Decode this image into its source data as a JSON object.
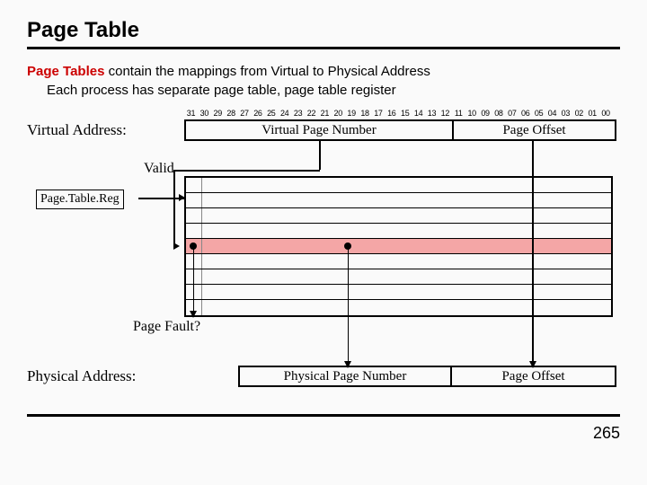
{
  "title": "Page Table",
  "body": {
    "line1_red": "Page Tables",
    "line1_rest": " contain the mappings from Virtual to Physical Address",
    "line2": "Each process has separate page table, page table register"
  },
  "bits": [
    "31",
    "30",
    "29",
    "28",
    "27",
    "26",
    "25",
    "24",
    "23",
    "22",
    "21",
    "20",
    "19",
    "18",
    "17",
    "16",
    "15",
    "14",
    "13",
    "12",
    "11",
    "10",
    "09",
    "08",
    "07",
    "06",
    "05",
    "04",
    "03",
    "02",
    "01",
    "00"
  ],
  "labels": {
    "virtual_address": "Virtual Address:",
    "vpn": "Virtual Page Number",
    "page_offset": "Page Offset",
    "valid": "Valid",
    "ptr": "Page.Table.Reg",
    "page_fault": "Page Fault?",
    "physical_address": "Physical Address:",
    "ppn": "Physical Page Number"
  },
  "page_number": "265"
}
